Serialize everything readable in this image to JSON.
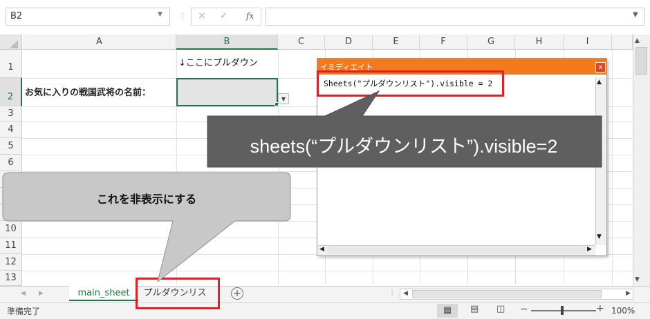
{
  "formula_bar": {
    "name_box": "B2",
    "cancel_glyph": "×",
    "enter_glyph": "✓",
    "fx_label": "fx",
    "formula_value": ""
  },
  "grid": {
    "columns": [
      "A",
      "B",
      "C",
      "D",
      "E",
      "F",
      "G",
      "H",
      "I"
    ],
    "rows": [
      "1",
      "2",
      "3",
      "4",
      "5",
      "6",
      "7",
      "8",
      "9",
      "10",
      "11",
      "12",
      "13"
    ],
    "selected_column": "B",
    "selected_row": "2",
    "cells": {
      "b1": "↓ここにプルダウン",
      "a2": "お気に入りの戦国武将の名前："
    }
  },
  "immediate_window": {
    "title": "イミディエイト",
    "close_label": "x",
    "code": "Sheets(\"プルダウンリスト\").visible = 2"
  },
  "callouts": {
    "code_hint": "sheets(“プルダウンリスト”).visible=2",
    "tab_hint": "これを非表示にする"
  },
  "sheet_tabs": {
    "tabs": [
      {
        "label": "main_sheet",
        "active": true
      },
      {
        "label": "プルダウンリスト",
        "active": false
      }
    ],
    "add_label": "+"
  },
  "status_bar": {
    "status": "準備完了",
    "zoom": "100%",
    "zoom_minus": "−",
    "zoom_plus": "+"
  },
  "colors": {
    "excel_green": "#217346",
    "immediate_titlebar": "#f47b1d",
    "highlight_red": "#e31e24",
    "callout_dark": "#5f5f5f",
    "callout_light": "#c8c8c8"
  },
  "icons": {
    "add_sheet": "plus-circle-icon",
    "dropdown": "chevron-down-icon",
    "view_normal": "grid-view-icon",
    "view_layout": "page-layout-icon",
    "view_break": "page-break-icon"
  }
}
